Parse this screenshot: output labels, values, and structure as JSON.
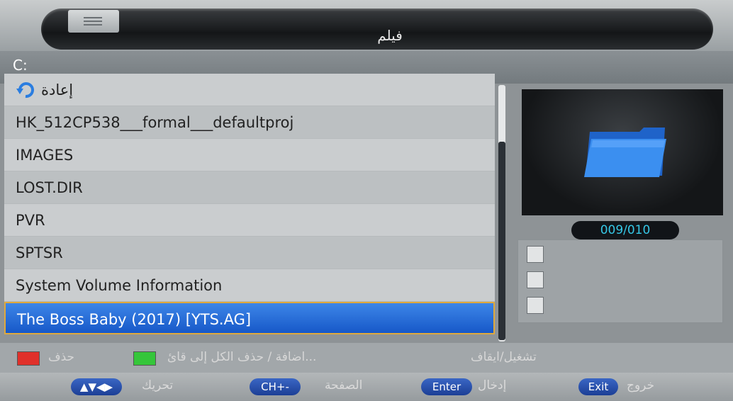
{
  "header": {
    "title": "فيلم",
    "path": "C:"
  },
  "list": {
    "back_label": "إعادة",
    "items": [
      "HK_512CP538___formal___defaultproj",
      "IMAGES",
      "LOST.DIR",
      "PVR",
      "SPTSR",
      "System Volume Information",
      "The Boss Baby (2017) [YTS.AG]"
    ],
    "selected_index": 6
  },
  "preview": {
    "counter": "009/010",
    "icon": "folder-icon"
  },
  "legend": {
    "delete_label": "حذف",
    "add_delete_all_label": "اضافة / حذف الكل إلى قائ...",
    "play_label": "تشغيل/ايقاف",
    "colors": {
      "red": "#e0302a",
      "green": "#35c63a"
    }
  },
  "hints": {
    "move_key": "▲▼◀▶",
    "move_label": "تحريك",
    "page_key": "CH+-",
    "page_label": "الصفحة",
    "enter_key": "Enter",
    "enter_label": "إدخال",
    "exit_key": "Exit",
    "exit_label": "خروج"
  }
}
